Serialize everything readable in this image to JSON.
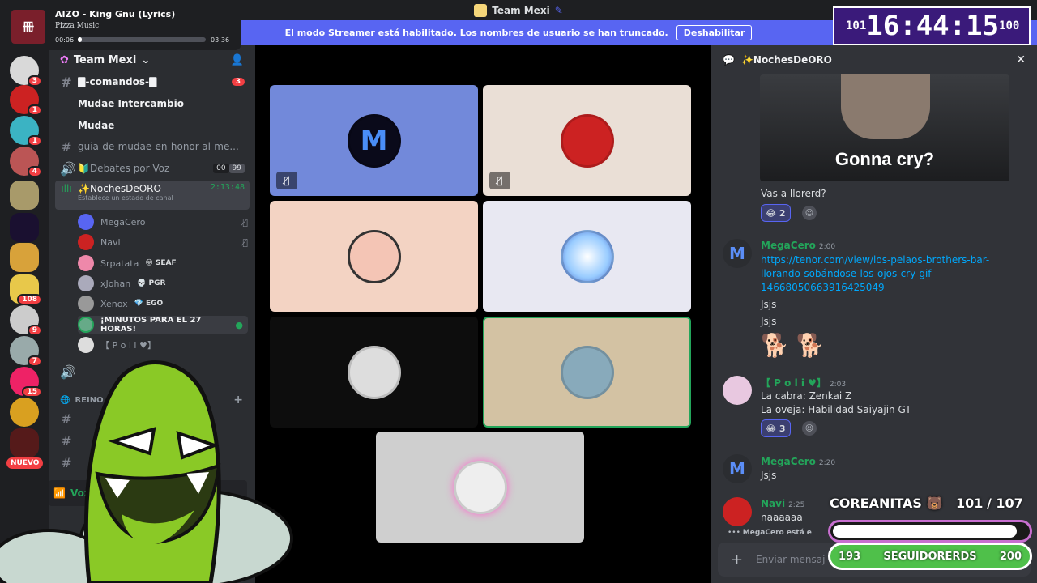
{
  "window": {
    "title": "Team Mexi"
  },
  "banner": {
    "text": "El modo Streamer está habilitado. Los nombres de usuario se han truncado.",
    "button": "Deshabilitar"
  },
  "now_playing": {
    "title": "AIZO - King Gnu (Lyrics)",
    "artist": "Pizza Music",
    "elapsed": "00:06",
    "duration": "03:36",
    "progress_fraction": 0.03
  },
  "timer": {
    "left": "101",
    "time": "16:44:15",
    "right": "100"
  },
  "rail": {
    "badges": [
      "3",
      "1",
      "1",
      "4",
      "8",
      "108",
      "9",
      "7",
      "15"
    ],
    "new_label": "NUEVO"
  },
  "server": {
    "name": "Team Mexi"
  },
  "channels": [
    {
      "name": "🀫-comandos-🀫",
      "badge": "3"
    },
    {
      "name": "Mudae Intercambio"
    },
    {
      "name": "Mudae"
    },
    {
      "name": "guia-de-mudae-en-honor-al-me..."
    },
    {
      "name": "🔰Debates por Voz",
      "count_a": "00",
      "count_b": "99"
    },
    {
      "name": "✨NochesDeORO",
      "timer": "2:13:48",
      "status": "Establece un estado de canal"
    }
  ],
  "voice_users": [
    {
      "name": "MegaCero"
    },
    {
      "name": "Navi"
    },
    {
      "name": "Srpatata",
      "tag": "😝 SEAF"
    },
    {
      "name": "xJohan",
      "tag": "💀 PGR"
    },
    {
      "name": "Xenox",
      "tag": "💎 EGO"
    },
    {
      "name": "¡MINUTOS PARA EL 27 HORAS!"
    },
    {
      "name": "【 P o l i ♥】"
    }
  ],
  "category": {
    "name": "REINO"
  },
  "voice_channel_footer": "Voz co",
  "chat": {
    "channel": "✨NochesDeORO",
    "gif_caption": "Gonna cry?",
    "messages": [
      {
        "text": "Vas a llorerd?",
        "reaction_count": "2"
      },
      {
        "author": "MegaCero",
        "time": "2:00",
        "link": "https://tenor.com/view/los-pelaos-brothers-bar-llorando-sobándose-los-ojos-cry-gif-14668050663916425049",
        "lines": [
          "Jsjs",
          "Jsjs"
        ]
      },
      {
        "author": "【 P o l i ♥】",
        "time": "2:03",
        "lines": [
          "La cabra: Zenkai Z",
          "La oveja: Habilidad Saiyajin GT"
        ],
        "reaction_count": "3"
      },
      {
        "author": "MegaCero",
        "time": "2:20",
        "lines": [
          "Jsjs"
        ]
      },
      {
        "author": "Navi",
        "time": "2:25",
        "lines": [
          "naaaaaa"
        ]
      }
    ],
    "typing": "MegaCero está e",
    "input_placeholder": "Enviar mensaj"
  },
  "goals": {
    "title": "COREANITAS 🐻",
    "current": "101",
    "target": "/ 107",
    "follow_left": "193",
    "follow_label": "SEGUIDORERDS",
    "follow_right": "200"
  },
  "colors": {
    "blurple": "#5865f2",
    "green": "#23a55a",
    "red": "#f23f43"
  }
}
